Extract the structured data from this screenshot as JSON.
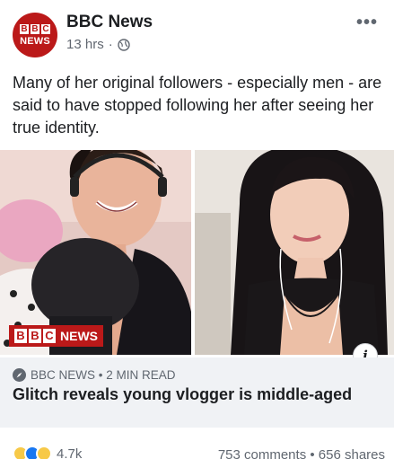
{
  "post": {
    "page_name": "BBC News",
    "time": "13 hrs",
    "separator": "·",
    "more": "•••",
    "caption": "Many of her original followers - especially men - are said to have stopped following her after seeing her true identity."
  },
  "avatar": {
    "blocks": [
      "B",
      "B",
      "C"
    ],
    "text": "NEWS"
  },
  "image_tag": {
    "blocks": [
      "B",
      "B",
      "C"
    ],
    "text": "NEWS"
  },
  "info_label": "i",
  "link": {
    "source": "BBC NEWS • 2 MIN READ",
    "headline": "Glitch reveals young vlogger is middle-aged"
  },
  "footer": {
    "reaction_count": "4.7k",
    "stats": "753 comments • 656 shares"
  },
  "colors": {
    "bbc_red": "#bb1919",
    "text": "#1c1e21",
    "muted": "#606770",
    "link_bg": "#f0f2f5"
  }
}
